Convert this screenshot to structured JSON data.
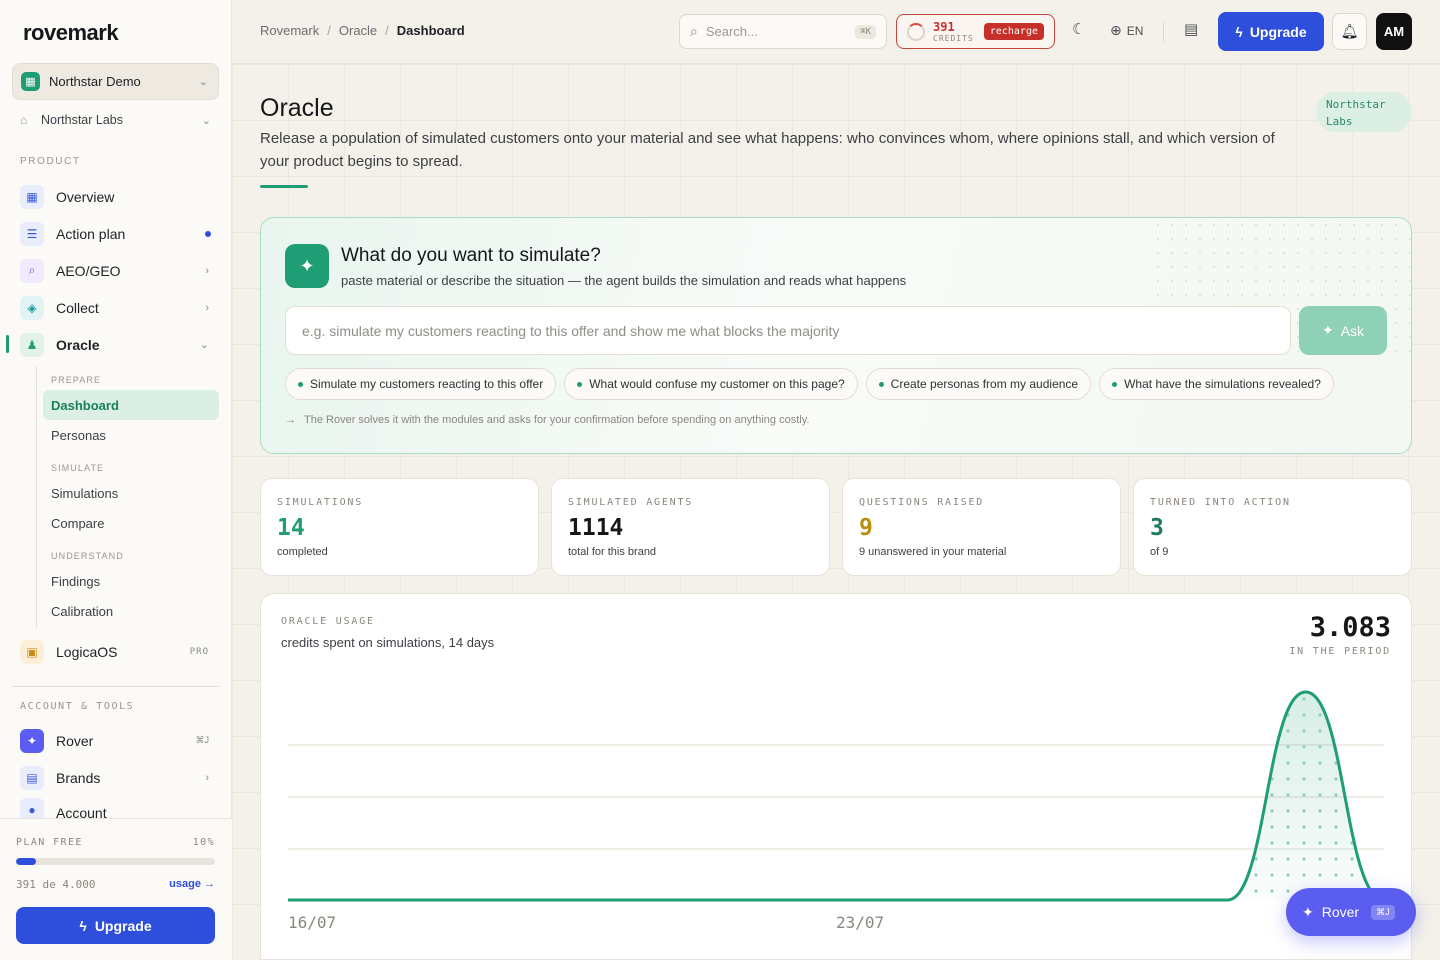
{
  "brand": {
    "logo": "rovemark"
  },
  "sidebar": {
    "workspace": "Northstar Demo",
    "org": "Northstar Labs",
    "section_product": "PRODUCT",
    "items": [
      {
        "label": "Overview",
        "icon": "grid-icon"
      },
      {
        "label": "Action plan",
        "icon": "list-check-icon"
      },
      {
        "label": "AEO/GEO",
        "icon": "search-icon"
      },
      {
        "label": "Collect",
        "icon": "layers-icon"
      },
      {
        "label": "Oracle",
        "icon": "users-icon"
      }
    ],
    "oracle_sub": {
      "prepare": "PREPARE",
      "dashboard": "Dashboard",
      "personas": "Personas",
      "simulate": "SIMULATE",
      "simulations": "Simulations",
      "compare": "Compare",
      "understand": "UNDERSTAND",
      "findings": "Findings",
      "calibration": "Calibration"
    },
    "logicaos": "LogicaOS",
    "logicaos_badge": "PRO",
    "section_account": "ACCOUNT & TOOLS",
    "rover": "Rover",
    "rover_kbd": "⌘J",
    "brands": "Brands",
    "account": "Account",
    "plan_label": "PLAN FREE",
    "plan_pct": "10%",
    "plan_progress": 0.1,
    "plan_usage": "391 de 4.000",
    "usage_link": "usage →",
    "upgrade": "Upgrade"
  },
  "header": {
    "breadcrumb": [
      "Rovemark",
      "Oracle",
      "Dashboard"
    ],
    "search_placeholder": "Search...",
    "search_kbd": "⌘K",
    "credits_value": "391",
    "credits_label": "CREDITS",
    "recharge": "recharge",
    "lang": "EN",
    "upgrade": "Upgrade",
    "avatar": "AM"
  },
  "page": {
    "title": "Oracle",
    "description": "Release a population of simulated customers onto your material and see what happens: who convinces whom, where opinions stall, and which version of your product begins to spread.",
    "org_chip": "Northstar Labs"
  },
  "ask": {
    "title": "What do you want to simulate?",
    "subtitle": "paste material or describe the situation — the agent builds the simulation and reads what happens",
    "placeholder": "e.g. simulate my customers reacting to this offer and show me what blocks the majority",
    "button": "Ask",
    "chips": [
      "Simulate my customers reacting to this offer",
      "What would confuse my customer on this page?",
      "Create personas from my audience",
      "What have the simulations revealed?"
    ],
    "note": "The Rover solves it with the modules and asks for your confirmation before spending on anything costly."
  },
  "stats": [
    {
      "label": "SIMULATIONS",
      "value": "14",
      "sub": "completed",
      "color": "#1f9d74"
    },
    {
      "label": "SIMULATED AGENTS",
      "value": "1114",
      "sub": "total for this brand",
      "color": "#15171a"
    },
    {
      "label": "QUESTIONS RAISED",
      "value": "9",
      "sub": "9 unanswered in your material",
      "color": "#b8900f"
    },
    {
      "label": "TURNED INTO ACTION",
      "value": "3",
      "sub": "of 9",
      "color": "#1f7a5a"
    }
  ],
  "usage": {
    "label": "ORACLE USAGE",
    "subtitle": "credits spent on simulations, 14 days",
    "total": "3.083",
    "period": "IN THE PERIOD"
  },
  "chart_data": {
    "type": "area",
    "x_tick_labels": [
      "16/07",
      "23/07"
    ],
    "values": [
      0,
      0,
      0,
      0,
      0,
      0,
      0,
      0,
      0,
      0,
      0,
      0,
      0,
      3083,
      0
    ],
    "grid": true,
    "color": "#1f9d74"
  },
  "rover_fab": {
    "label": "Rover",
    "kbd": "⌘J"
  }
}
